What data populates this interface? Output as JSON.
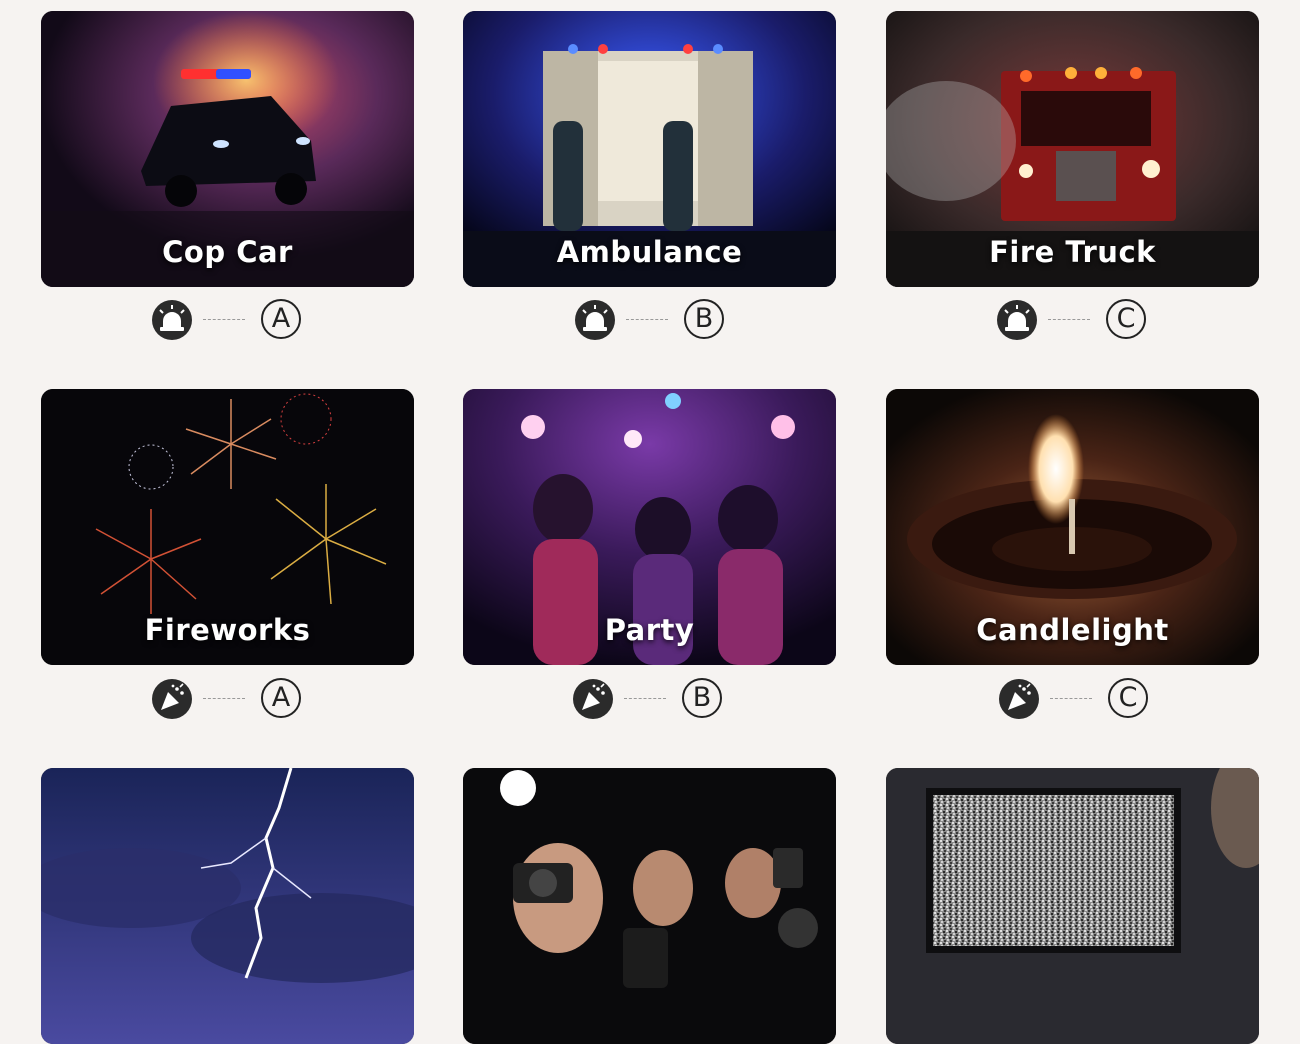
{
  "cards": [
    {
      "label": "Cop Car"
    },
    {
      "label": "Ambulance"
    },
    {
      "label": "Fire Truck"
    },
    {
      "label": "Fireworks"
    },
    {
      "label": "Party"
    },
    {
      "label": "Candlelight"
    },
    {
      "label": ""
    },
    {
      "label": ""
    },
    {
      "label": ""
    }
  ],
  "indicators": [
    {
      "icon": "siren-icon",
      "letter": "A"
    },
    {
      "icon": "siren-icon",
      "letter": "B"
    },
    {
      "icon": "siren-icon",
      "letter": "C"
    },
    {
      "icon": "party-popper-icon",
      "letter": "A"
    },
    {
      "icon": "party-popper-icon",
      "letter": "B"
    },
    {
      "icon": "party-popper-icon",
      "letter": "C"
    }
  ],
  "colors": {
    "background": "#f6f3f1",
    "icon_fill": "#2b2b2b",
    "letter_stroke": "#222222"
  }
}
